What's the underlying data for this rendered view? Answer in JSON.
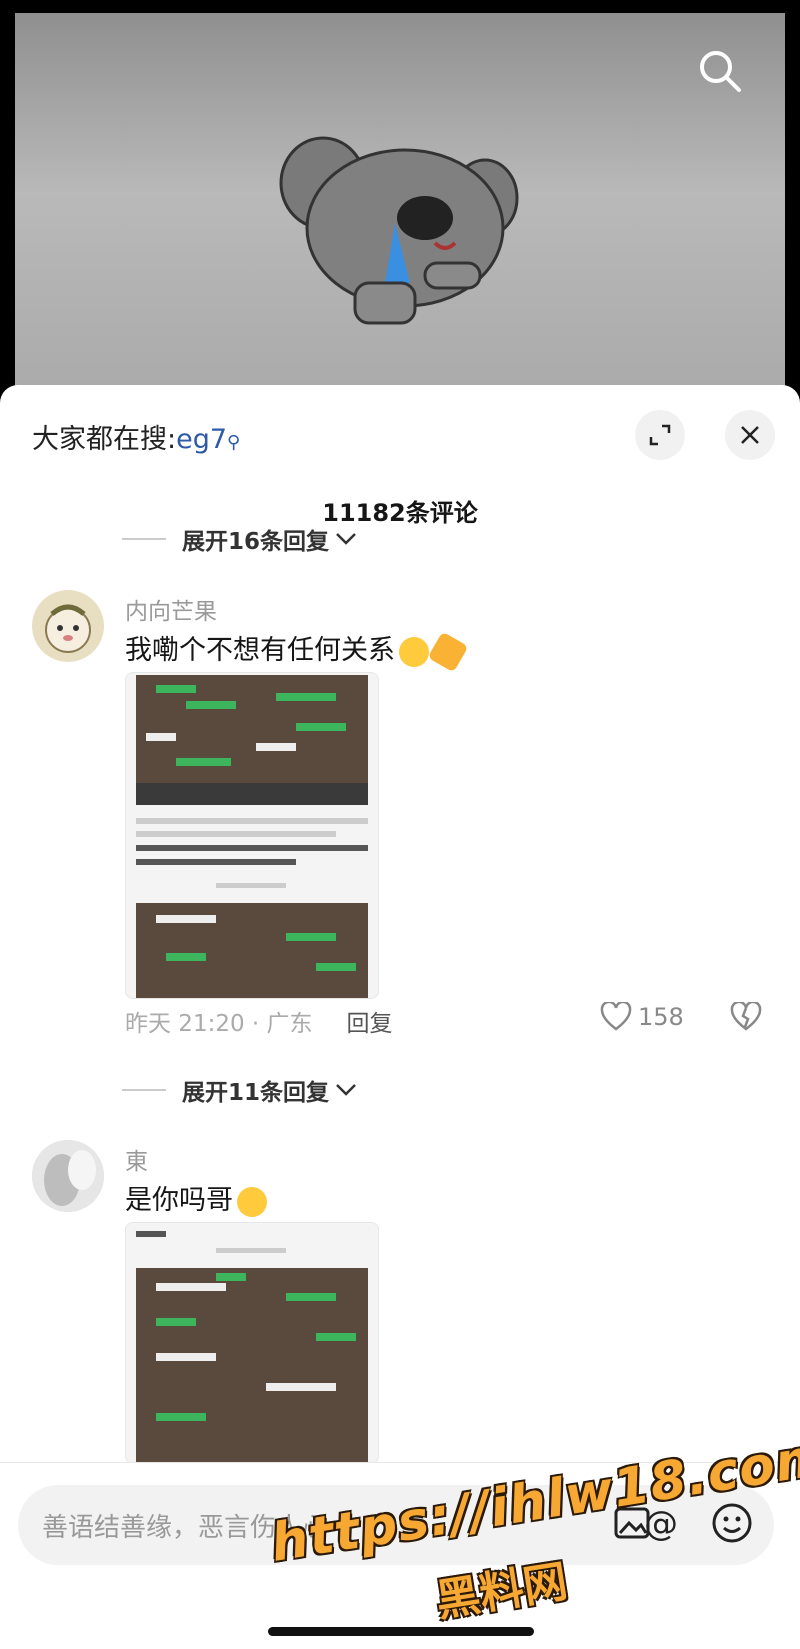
{
  "video": {
    "search_icon": "search-icon"
  },
  "sheet": {
    "trending_prefix": "大家都在搜:",
    "trending_keyword": "eg7",
    "comment_count": "11182条评论"
  },
  "threads": [
    {
      "expand_label": "展开16条回复"
    },
    {
      "expand_label": "展开11条回复"
    }
  ],
  "comments": [
    {
      "username": "内向芒果",
      "text": "我嘞个不想有任何关系",
      "time_location": "昨天 21:20 · 广东",
      "reply_label": "回复",
      "likes": "158"
    },
    {
      "username": "東",
      "text": "是你吗哥"
    }
  ],
  "input": {
    "placeholder": "善语结善缘，恶言伤人心"
  },
  "watermark": {
    "line1": "https://ihlw18.com",
    "line2": "黑料网"
  },
  "colors": {
    "keyword": "#2e5aa8",
    "watermark": "#f7a833"
  }
}
